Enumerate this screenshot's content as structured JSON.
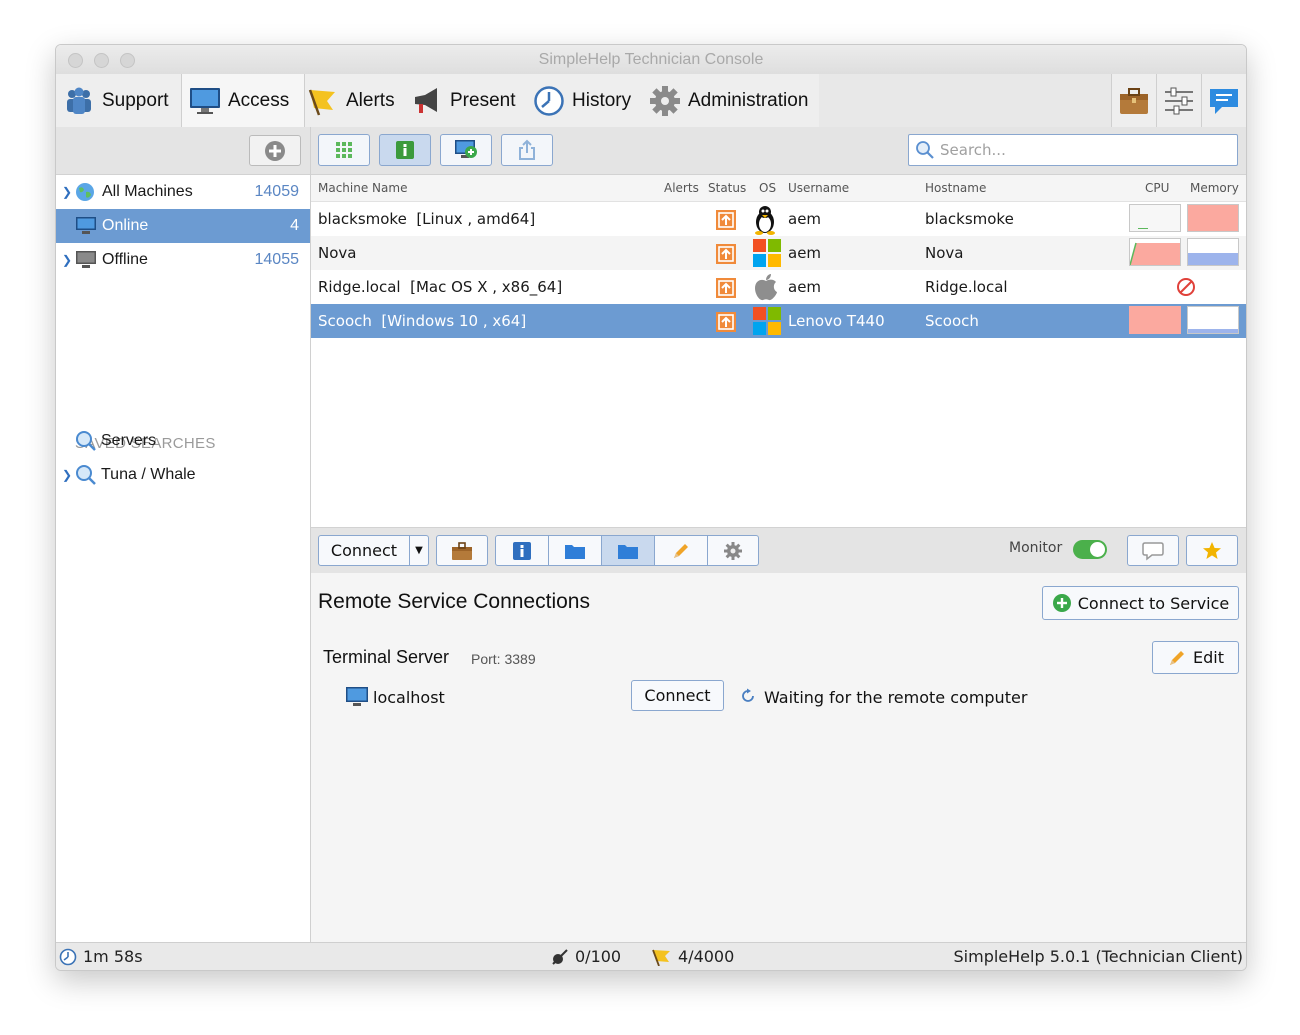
{
  "window": {
    "title": "SimpleHelp Technician Console"
  },
  "nav": {
    "tabs": [
      {
        "label": "Support",
        "icon": "people-icon"
      },
      {
        "label": "Access",
        "icon": "monitor-icon"
      },
      {
        "label": "Alerts",
        "icon": "flag-icon"
      },
      {
        "label": "Present",
        "icon": "megaphone-icon"
      },
      {
        "label": "History",
        "icon": "clock-icon"
      },
      {
        "label": "Administration",
        "icon": "gear-icon"
      }
    ],
    "active_tab": "Access",
    "right_icons": [
      "toolbox-icon",
      "settings-sliders-icon",
      "messages-icon"
    ]
  },
  "sidebar": {
    "items": [
      {
        "label": "All Machines",
        "count": "14059"
      },
      {
        "label": "Online",
        "count": "4"
      },
      {
        "label": "Offline",
        "count": "14055"
      }
    ],
    "saved_searches_label": "SAVED SEARCHES",
    "saved_searches": [
      {
        "label": "Servers"
      },
      {
        "label": "Tuna / Whale"
      }
    ]
  },
  "search": {
    "placeholder": "Search..."
  },
  "table": {
    "columns": [
      "Machine Name",
      "Alerts",
      "Status",
      "OS",
      "Username",
      "Hostname",
      "CPU",
      "Memory"
    ],
    "rows": [
      {
        "machine": "blacksmoke  [Linux , amd64]",
        "os": "linux",
        "username": "aem",
        "hostname": "blacksmoke"
      },
      {
        "machine": "Nova",
        "os": "windows",
        "username": "aem",
        "hostname": "Nova"
      },
      {
        "machine": "Ridge.local  [Mac OS X , x86_64]",
        "os": "mac",
        "username": "aem",
        "hostname": "Ridge.local"
      },
      {
        "machine": "Scooch  [Windows 10 , x64]",
        "os": "windows",
        "username": "Lenovo T440",
        "hostname": "Scooch"
      }
    ],
    "selected_row": 3
  },
  "actions": {
    "connect_label": "Connect",
    "monitor_label": "Monitor",
    "monitor_on": true
  },
  "detail": {
    "title": "Remote Service Connections",
    "connect_service_label": "Connect to Service",
    "service_name": "Terminal Server",
    "port_label": "Port: 3389",
    "edit_label": "Edit",
    "host": "localhost",
    "host_connect_label": "Connect",
    "waiting_text": "Waiting for the remote computer"
  },
  "status": {
    "timer": "1m 58s",
    "connections": "0/100",
    "alerts": "4/4000",
    "version": "SimpleHelp 5.0.1 (Technician Client)"
  },
  "colors": {
    "accent": "#6c9bd2",
    "selection": "#6c9bd2",
    "cpu_mem_fill": "#fba99f",
    "button_border": "#8aa7cf"
  }
}
